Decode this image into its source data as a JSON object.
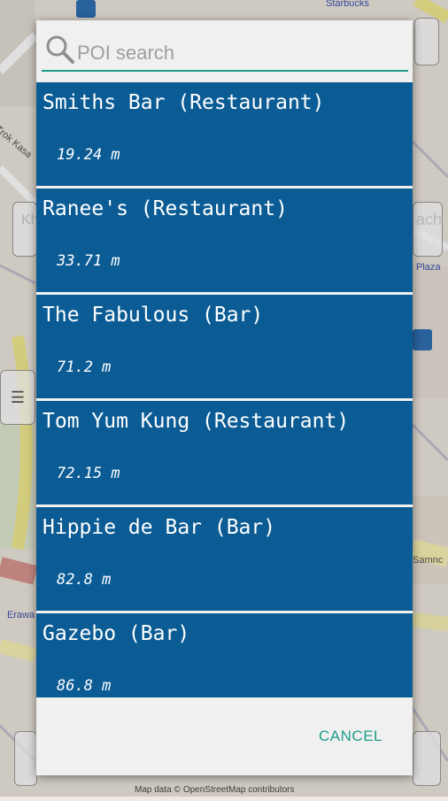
{
  "map": {
    "labels": [
      "Starbucks",
      "Trok Kasa",
      "ach",
      "Plaza",
      "Erawa",
      "Samnc",
      "Kh"
    ],
    "attribution": [
      "Map data ©",
      "OpenStreetMap contributors"
    ]
  },
  "search": {
    "placeholder": "POI search",
    "value": ""
  },
  "results": [
    {
      "name": "Smiths Bar (Restaurant)",
      "distance": "19.24 m"
    },
    {
      "name": "Ranee's (Restaurant)",
      "distance": "33.71 m"
    },
    {
      "name": "The Fabulous (Bar)",
      "distance": "71.2 m"
    },
    {
      "name": "Tom Yum Kung (Restaurant)",
      "distance": "72.15 m"
    },
    {
      "name": "Hippie de Bar (Bar)",
      "distance": "82.8 m"
    },
    {
      "name": "Gazebo (Bar)",
      "distance": "86.8 m"
    }
  ],
  "footer": {
    "cancel_label": "CANCEL"
  },
  "colors": {
    "item_background": "#0b5c95",
    "accent": "#1e9e8a",
    "dialog_background": "#f0f0f0"
  }
}
